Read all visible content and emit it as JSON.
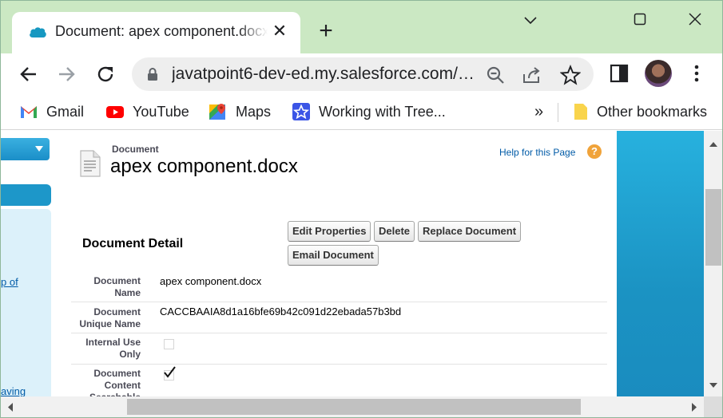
{
  "browser": {
    "tab_title": "Document: apex component.docx",
    "url": "javatpoint6-dev-ed.my.salesforce.com/…",
    "new_tab": "+",
    "close_tab": "✕",
    "window_controls": {
      "minimize": "⌄",
      "maximize": "☐",
      "close": "✕"
    },
    "bookmarks": [
      {
        "label": "Gmail",
        "icon": "gmail-icon"
      },
      {
        "label": "YouTube",
        "icon": "youtube-icon"
      },
      {
        "label": "Maps",
        "icon": "maps-icon"
      },
      {
        "label": "Working with Tree...",
        "icon": "bookmark-star-icon"
      }
    ],
    "bookmarks_overflow": "»",
    "other_bookmarks": "Other bookmarks"
  },
  "sidebar": {
    "links": [
      "p of",
      "aving"
    ]
  },
  "page": {
    "breadcrumb": "Document",
    "title": "apex component.docx",
    "help_link": "Help for this Page",
    "help_icon": "?"
  },
  "detail": {
    "section_title": "Document Detail",
    "buttons": {
      "edit": "Edit Properties",
      "delete": "Delete",
      "replace": "Replace Document",
      "email": "Email Document"
    },
    "fields": [
      {
        "label": "Document Name",
        "value": "apex component.docx"
      },
      {
        "label": "Document Unique Name",
        "value": "CACCBAAIA8d1a16bfe69b42c091d22ebada57b3bd"
      },
      {
        "label": "Internal Use Only",
        "checked": false
      },
      {
        "label": "Document Content Searchable",
        "checked": true
      }
    ]
  },
  "colors": {
    "tabstrip": "#cbe8c3",
    "salesforce_blue": "#1d97c9",
    "link": "#015ba7"
  }
}
